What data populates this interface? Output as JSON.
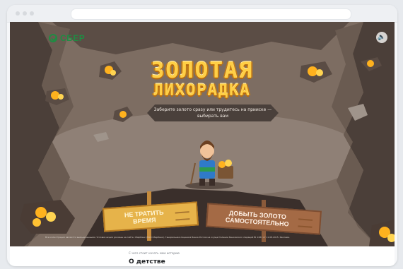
{
  "game": {
    "brand": "СБЕР",
    "title_line1": "ЗОЛОТАЯ",
    "title_line2": "ЛИХОРАДКА",
    "subtitle": "Заберите золото сразу или трудитесь на прииске — выбирать вам",
    "choice_left": "НЕ ТРАТИТЬ ВРЕМЯ",
    "choice_right": "ДОБЫТЬ ЗОЛОТО САМОСТОЯТЕЛЬНО",
    "disclaimer": "Все иллюстрации являются вымышленными. Условия акции указаны на сайте. Сбербанк (ПАО Сбербанк), Генеральная лицензия Банка России на осуществление банковских операций № 1481 от 11.08.2015. Реклама."
  },
  "page": {
    "caption": "С чего стоит начать мою историю",
    "section_title": "О детстве"
  },
  "icons": {
    "logo": "sber-logo-icon",
    "sound": "sound-icon",
    "miner": "miner-character-icon",
    "gold": "gold-nugget-icon"
  },
  "colors": {
    "gold": "#ffcf45",
    "rock_dark": "#4b3f39",
    "rock_mid": "#7a6a5f",
    "sign_gold": "#e6b34a",
    "sign_wood": "#a46a45",
    "brand_green": "#1f8c43"
  }
}
